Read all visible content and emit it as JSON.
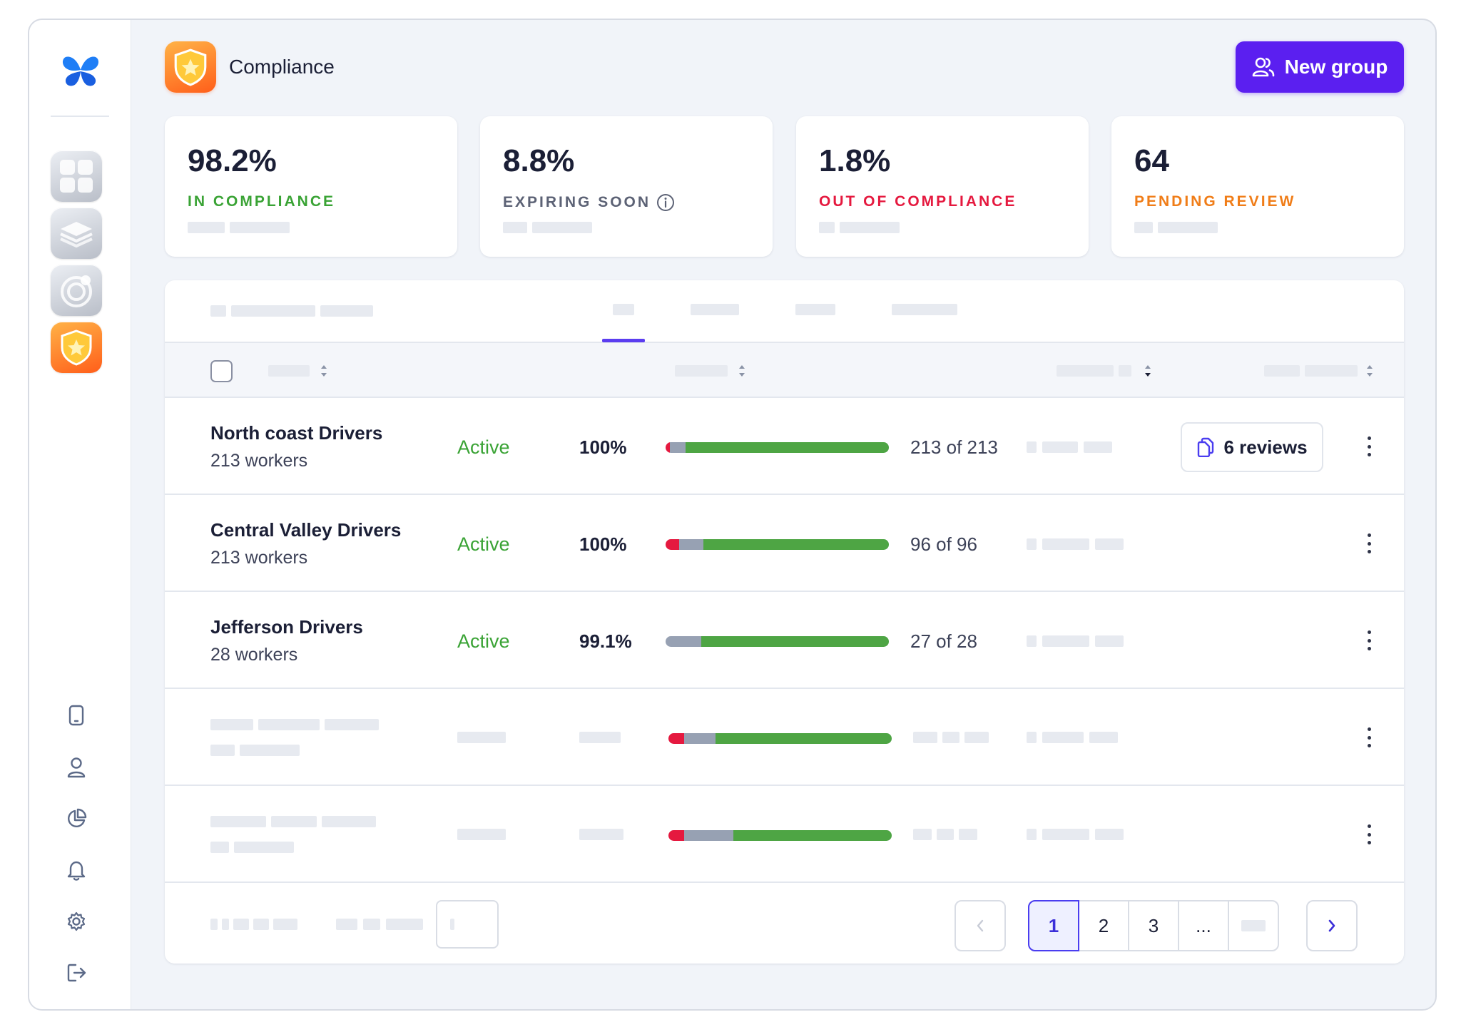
{
  "header": {
    "title": "Compliance",
    "new_group_label": "New group"
  },
  "stats": [
    {
      "value": "98.2%",
      "label": "IN COMPLIANCE",
      "color": "#3aa335"
    },
    {
      "value": "8.8%",
      "label": "EXPIRING SOON",
      "color": "#5c6275",
      "info_icon": "info-icon"
    },
    {
      "value": "1.8%",
      "label": "OUT OF COMPLIANCE",
      "color": "#e5193f"
    },
    {
      "value": "64",
      "label": "PENDING REVIEW",
      "color": "#f07d18"
    }
  ],
  "rows": [
    {
      "name": "North coast Drivers",
      "workers": "213 workers",
      "status": "Active",
      "percent": "100%",
      "count": "213 of 213",
      "reviews": "6 reviews",
      "bar": {
        "red": 0.02,
        "gray": 0.07,
        "green": 0.91
      }
    },
    {
      "name": "Central Valley Drivers",
      "workers": "213 workers",
      "status": "Active",
      "percent": "100%",
      "count": "96 of 96",
      "bar": {
        "red": 0.06,
        "gray": 0.11,
        "green": 0.83
      }
    },
    {
      "name": "Jefferson Drivers",
      "workers": "28 workers",
      "status": "Active",
      "percent": "99.1%",
      "count": "27 of 28",
      "bar": {
        "red": 0.0,
        "gray": 0.16,
        "green": 0.84
      }
    },
    {
      "placeholder": true,
      "bar": {
        "red": 0.07,
        "gray": 0.14,
        "green": 0.79
      }
    },
    {
      "placeholder": true,
      "bar": {
        "red": 0.07,
        "gray": 0.22,
        "green": 0.71
      }
    }
  ],
  "pagination": {
    "pages": [
      "1",
      "2",
      "3",
      "..."
    ],
    "current": "1"
  },
  "colors": {
    "accent": "#5b1ff0",
    "active_status": "#3aa335",
    "bar_red": "#e5193f",
    "bar_gray": "#97a1b3",
    "bar_green": "#4ea544"
  }
}
